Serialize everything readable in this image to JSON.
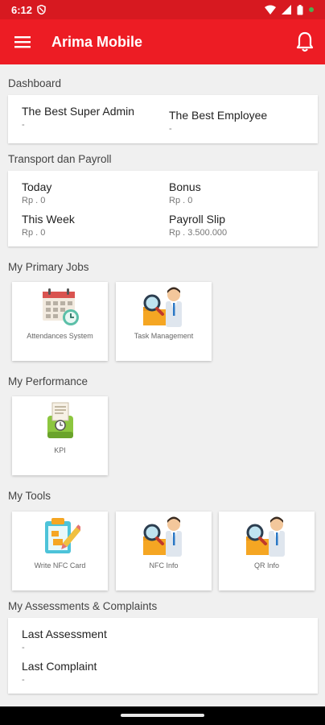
{
  "status_bar": {
    "time": "6:12"
  },
  "app_bar": {
    "title": "Arima Mobile"
  },
  "dashboard": {
    "title": "Dashboard",
    "admin_label": "The Best Super Admin",
    "admin_value": "-",
    "employee_label": "The Best Employee",
    "employee_value": "-"
  },
  "transport": {
    "title": "Transport dan Payroll",
    "today_label": "Today",
    "today_value": "Rp . 0",
    "bonus_label": "Bonus",
    "bonus_value": "Rp . 0",
    "week_label": "This Week",
    "week_value": "Rp . 0",
    "payroll_label": "Payroll Slip",
    "payroll_value": "Rp . 3.500.000"
  },
  "primary_jobs": {
    "title": "My Primary Jobs",
    "items": [
      {
        "label": "Attendances System",
        "icon": "calendar-clock-icon"
      },
      {
        "label": "Task Management",
        "icon": "search-person-icon"
      }
    ]
  },
  "performance": {
    "title": "My Performance",
    "items": [
      {
        "label": "KPI",
        "icon": "kpi-machine-icon"
      }
    ]
  },
  "tools": {
    "title": "My Tools",
    "items": [
      {
        "label": "Write NFC Card",
        "icon": "clipboard-pencil-icon"
      },
      {
        "label": "NFC Info",
        "icon": "search-person-icon"
      },
      {
        "label": "QR Info",
        "icon": "search-person-icon"
      }
    ]
  },
  "assessments": {
    "title": "My Assessments & Complaints",
    "assessment_label": "Last Assessment",
    "assessment_value": "-",
    "complaint_label": "Last Complaint",
    "complaint_value": "-"
  },
  "colors": {
    "primary": "#ed1c24",
    "status_bar": "#d71920"
  }
}
